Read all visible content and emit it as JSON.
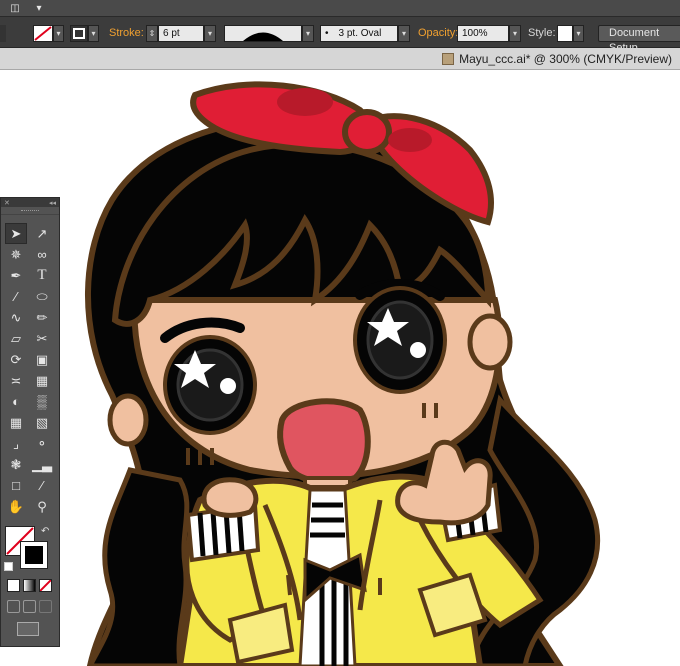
{
  "control_bar": {
    "stroke_label": "Stroke:",
    "stroke_weight": "6 pt",
    "brush_profile": "3 pt. Oval",
    "opacity_label": "Opacity:",
    "opacity_value": "100%",
    "style_label": "Style:",
    "document_setup_label": "Document Setup"
  },
  "document": {
    "tab_title": "Mayu_ccc.ai* @ 300% (CMYK/Preview)"
  },
  "tools_panel": {
    "tool_icons": [
      "selection-tool-icon",
      "direct-selection-tool-icon",
      "magic-wand-tool-icon",
      "lasso-tool-icon",
      "pen-tool-icon",
      "type-tool-icon",
      "line-segment-tool-icon",
      "ellipse-tool-icon",
      "paintbrush-tool-icon",
      "pencil-tool-icon",
      "blob-brush-tool-icon",
      "scissors-tool-icon",
      "rotate-tool-icon",
      "scale-tool-icon",
      "warp-tool-icon",
      "free-transform-tool-icon",
      "shape-builder-tool-icon",
      "graph-tool-icon",
      "mesh-tool-icon",
      "gradient-tool-icon",
      "eyedropper-tool-icon",
      "blend-tool-icon",
      "symbol-sprayer-tool-icon",
      "column-graph-tool-icon",
      "artboard-tool-icon",
      "slice-tool-icon",
      "hand-tool-icon",
      "zoom-tool-icon"
    ]
  },
  "colors": {
    "ui_dark": "#3c3c3c",
    "accent_label": "#f0a030",
    "outline": "#5a3a1a",
    "hair": "#050505",
    "skin": "#f0c0a0",
    "bow": "#e01e35",
    "jacket": "#f5e84a",
    "mouth": "#e05560"
  }
}
